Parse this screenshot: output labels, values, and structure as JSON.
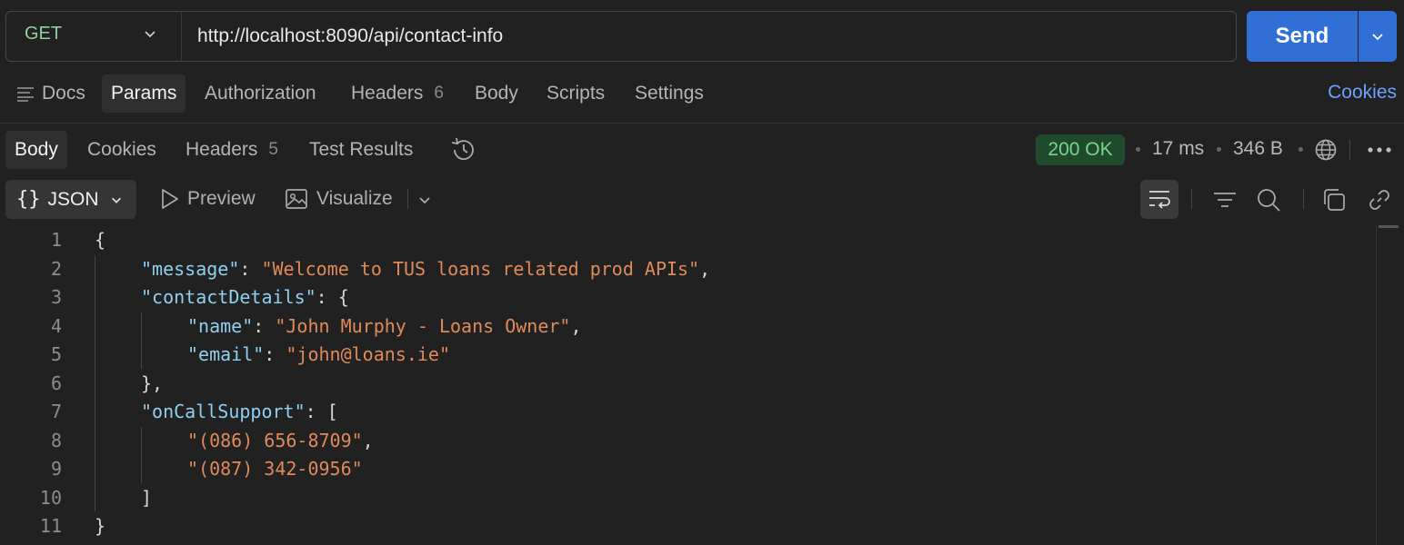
{
  "request": {
    "method": "GET",
    "url": "http://localhost:8090/api/contact-info",
    "send_label": "Send"
  },
  "request_tabs": {
    "docs": "Docs",
    "params": "Params",
    "authorization": "Authorization",
    "headers": "Headers",
    "headers_count": "6",
    "body": "Body",
    "scripts": "Scripts",
    "settings": "Settings",
    "cookies": "Cookies"
  },
  "response_tabs": {
    "body": "Body",
    "cookies": "Cookies",
    "headers": "Headers",
    "headers_count": "5",
    "test_results": "Test Results"
  },
  "response_meta": {
    "status": "200 OK",
    "time": "17 ms",
    "size": "346 B",
    "status_color": "#7ad48c"
  },
  "toolbar": {
    "format": "JSON",
    "preview": "Preview",
    "visualize": "Visualize"
  },
  "code_lines": [
    {
      "n": "1"
    },
    {
      "n": "2",
      "key": "\"message\"",
      "val": "\"Welcome to TUS loans related prod APIs\""
    },
    {
      "n": "3",
      "key": "\"contactDetails\""
    },
    {
      "n": "4",
      "key": "\"name\"",
      "val": "\"John Murphy - Loans Owner\""
    },
    {
      "n": "5",
      "key": "\"email\"",
      "val": "\"john@loans.ie\""
    },
    {
      "n": "6"
    },
    {
      "n": "7",
      "key": "\"onCallSupport\""
    },
    {
      "n": "8",
      "val": "\"(086) 656-8709\""
    },
    {
      "n": "9",
      "val": "\"(087) 342-0956\""
    },
    {
      "n": "10"
    },
    {
      "n": "11"
    }
  ],
  "icons": {
    "docs": "docs-lines-icon",
    "history": "history-icon",
    "globe": "globe-icon",
    "more": "more-horizontal-icon",
    "preview": "play-icon",
    "visualize": "image-icon",
    "wrap": "wrap-lines-icon",
    "filter": "filter-icon",
    "search": "search-icon",
    "copy": "copy-icon",
    "link": "link-icon"
  }
}
